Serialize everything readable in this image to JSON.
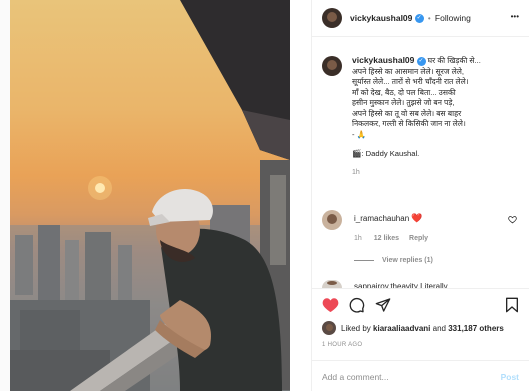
{
  "post": {
    "username": "vickykaushal09",
    "following_label": "Following",
    "dot": "•",
    "more_label": "•••"
  },
  "caption": {
    "username": "vickykaushal09",
    "lines": [
      "घर की खिड़की से...",
      "अपने हिस्से का आसमान लेले। सूरज लेले,",
      "सूर्यास्त लेले... तारों से भरी चाँदनी रात लेले।",
      "माँ को देख, बैठ, दो पल बिता... उसकी",
      "हसीन मुस्कान लेले। तुझसे जो बन पड़े,",
      "अपने हिस्से का तू वो सब लेले। बस बाहर",
      "निकलकर, गल्ती से किसिकी जान ना लेले।",
      "- 🙏"
    ],
    "credit": "🎬: Daddy Kaushal.",
    "time": "1h"
  },
  "comments": [
    {
      "username": "i_ramachauhan",
      "text": "❤️",
      "time": "1h",
      "likes": "12 likes",
      "reply": "Reply",
      "view_replies": "View replies (1)"
    }
  ],
  "partial_comment": "sapnajroy.theavity Literally",
  "actions": {
    "liked_by_prefix": "Liked by",
    "liked_by_user": "kiaraaliaadvani",
    "liked_by_and": "and",
    "liked_by_count": "331,187 others",
    "timestamp": "1 HOUR AGO"
  },
  "comment_box": {
    "placeholder": "Add a comment...",
    "post_label": "Post"
  },
  "colors": {
    "like_red": "#ed4956",
    "link_blue": "#3897f0",
    "post_disabled": "#b2dffc"
  }
}
